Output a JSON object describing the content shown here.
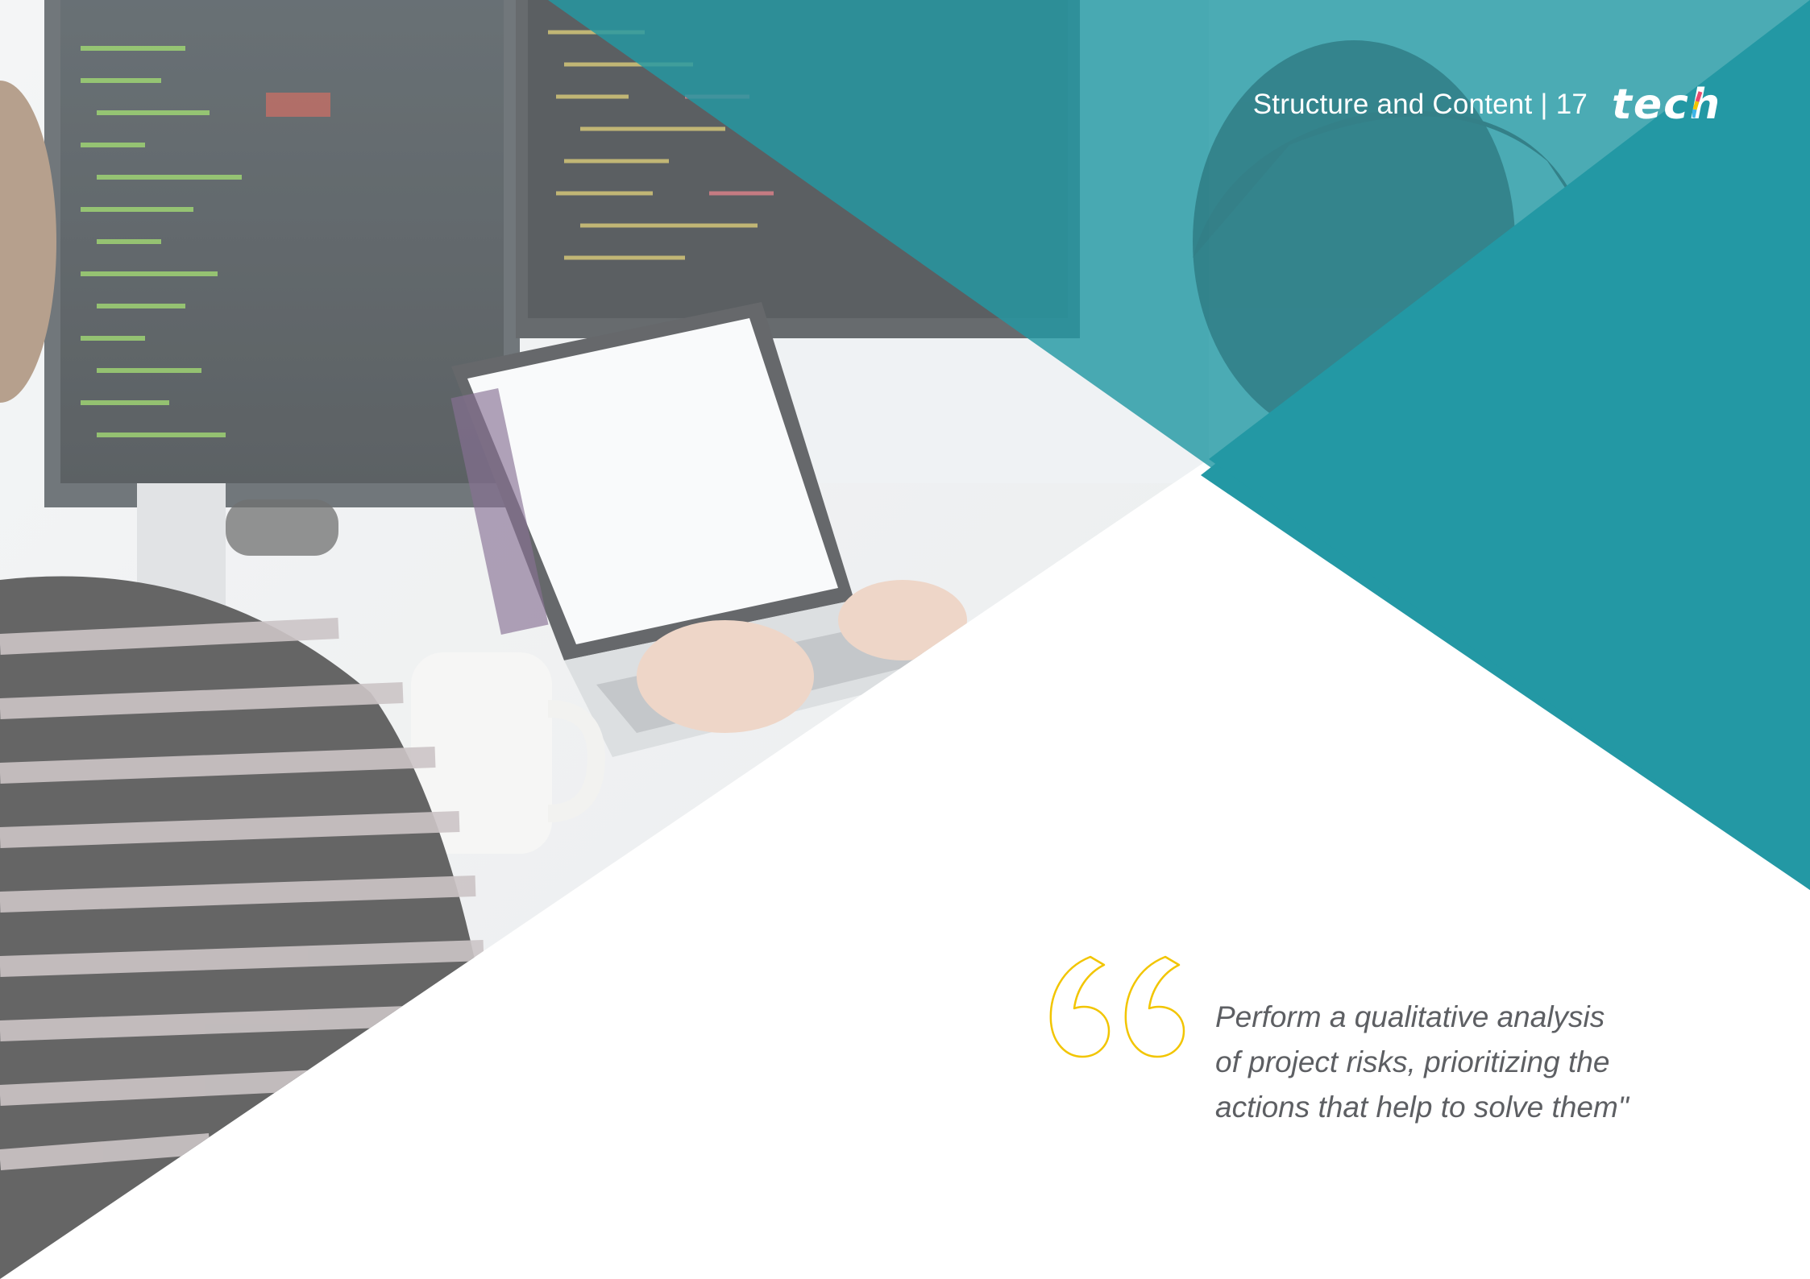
{
  "header": {
    "section_title": "Structure and Content",
    "separator": "|",
    "page_number": "17",
    "logo_text": "tech"
  },
  "quote": {
    "lines": [
      "Perform a qualitative analysis",
      "of project risks, prioritizing the",
      "actions that help to solve them\""
    ]
  },
  "colors": {
    "teal": "#2398a4",
    "teal_dark": "#1f7f8a",
    "quote_mark": "#f2c500",
    "quote_text": "#5d5f63",
    "header_text": "#ffffff"
  },
  "icons": {
    "quote_mark": "opening-quote-icon",
    "logo": "tech-logo"
  }
}
